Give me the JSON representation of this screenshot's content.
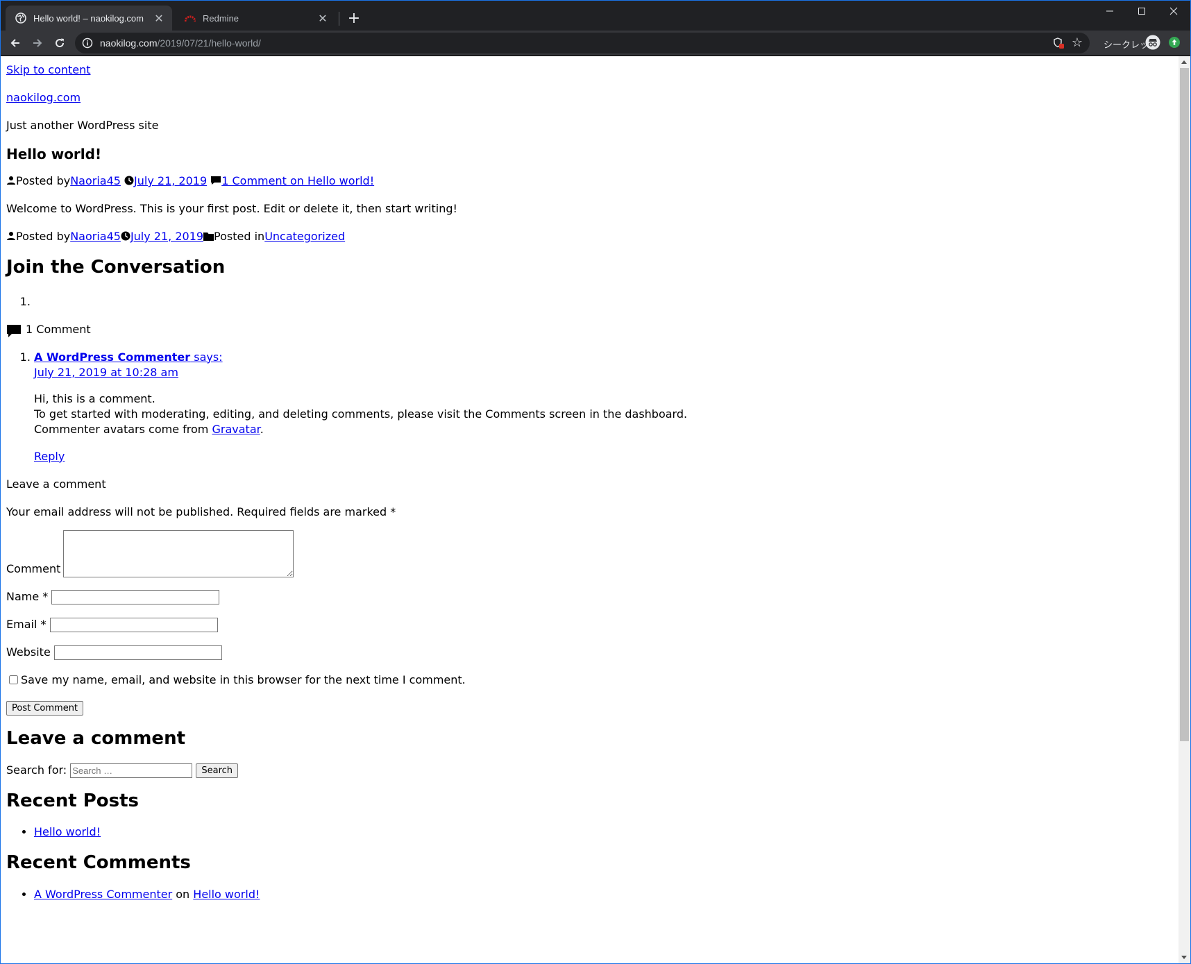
{
  "browser": {
    "tabs": [
      {
        "title": "Hello world! – naokilog.com",
        "active": true
      },
      {
        "title": "Redmine",
        "active": false
      }
    ],
    "tab_close": "✕",
    "new_tab": "+",
    "url_host": "naokilog.com",
    "url_path": "/2019/07/21/hello-world/",
    "incognito_label": "シークレット",
    "icons": [
      "back-arrow-icon",
      "forward-arrow-icon",
      "reload-icon",
      "info-icon",
      "shield-icon",
      "star-icon",
      "incognito-icon",
      "extension-icon"
    ]
  },
  "page": {
    "skip_link": "Skip to content",
    "site_title": "naokilog.com",
    "tagline": "Just another WordPress site",
    "post": {
      "title": "Hello world!",
      "posted_by": "Posted by",
      "author": "Naoria45",
      "date": "July 21, 2019",
      "comments_link": "1 Comment on Hello world!",
      "body": "Welcome to WordPress. This is your first post. Edit or delete it, then start writing!",
      "posted_in": "Posted in",
      "category": "Uncategorized"
    },
    "join_heading": "Join the Conversation",
    "empty_list_marker": "1.",
    "comment_count": "1 Comment",
    "comment": {
      "author": "A WordPress Commenter",
      "says": " says:",
      "date": "July 21, 2019 at 10:28 am",
      "line1": "Hi, this is a comment.",
      "line2": "To get started with moderating, editing, and deleting comments, please visit the Comments screen in the dashboard.",
      "line3_prefix": "Commenter avatars come from ",
      "line3_link": "Gravatar",
      "line3_suffix": ".",
      "reply": "Reply"
    },
    "form": {
      "leave_comment": "Leave a comment",
      "notes": "Your email address will not be published. Required fields are marked",
      "required_mark": "*",
      "comment_label": "Comment",
      "name_label": "Name",
      "email_label": "Email",
      "website_label": "Website",
      "cookies_label": "Save my name, email, and website in this browser for the next time I comment.",
      "submit": "Post Comment"
    },
    "widgets": {
      "leave_comment_heading": "Leave a comment",
      "search_label": "Search for:",
      "search_placeholder": "Search …",
      "search_button": "Search",
      "recent_posts_heading": "Recent Posts",
      "recent_posts": [
        "Hello world!"
      ],
      "recent_comments_heading": "Recent Comments",
      "recent_comment_author": "A WordPress Commenter",
      "recent_comment_on": " on ",
      "recent_comment_post": "Hello world!"
    }
  },
  "colors": {
    "link": "#0000ee",
    "chrome_dark": "#202124",
    "chrome_toolbar": "#35363a",
    "redmine_red": "#c8201e"
  }
}
